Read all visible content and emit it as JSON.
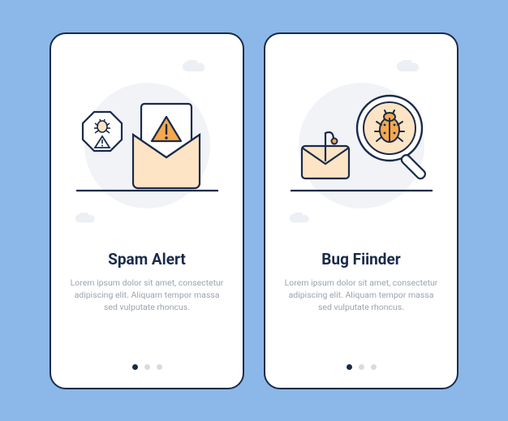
{
  "cards": [
    {
      "title": "Spam Alert",
      "body": "Lorem ipsum dolor sit amet, consectetur adipiscing elit. Aliquam tempor massa sed vulputate rhoncus.",
      "pagination": {
        "count": 3,
        "active_index": 0
      }
    },
    {
      "title": "Bug Fiinder",
      "body": "Lorem ipsum dolor sit amet, consectetur adipiscing elit. Aliquam tempor massa sed vulputate rhoncus.",
      "pagination": {
        "count": 3,
        "active_index": 0
      }
    }
  ],
  "colors": {
    "background": "#8bb8e8",
    "stroke": "#1a2b4a",
    "accent": "#f5a94b",
    "accent_fill": "#fde4c4",
    "muted": "#9aa3b2",
    "circle": "#f1f3f7"
  }
}
